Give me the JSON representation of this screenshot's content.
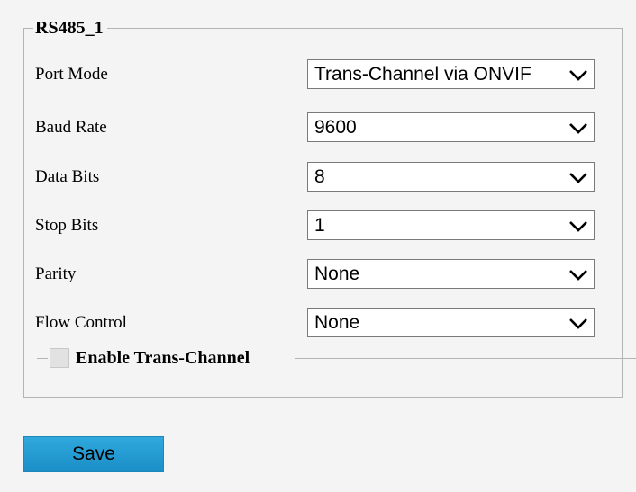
{
  "group": {
    "title": "RS485_1"
  },
  "fields": [
    {
      "label": "Port Mode",
      "value": "Trans-Channel via ONVIF"
    },
    {
      "label": "Baud Rate",
      "value": "9600"
    },
    {
      "label": "Data Bits",
      "value": "8"
    },
    {
      "label": "Stop Bits",
      "value": "1"
    },
    {
      "label": "Parity",
      "value": "None"
    },
    {
      "label": "Flow Control",
      "value": "None"
    }
  ],
  "trans_channel": {
    "label": "Enable Trans-Channel",
    "checked": false
  },
  "actions": {
    "save_label": "Save"
  },
  "icons": {
    "dropdown": "chevron-down-icon",
    "checkbox": "checkbox-unchecked"
  },
  "colors": {
    "background": "#f4f4f4",
    "border": "#b4b4b4",
    "button": "#1b8fc8"
  }
}
